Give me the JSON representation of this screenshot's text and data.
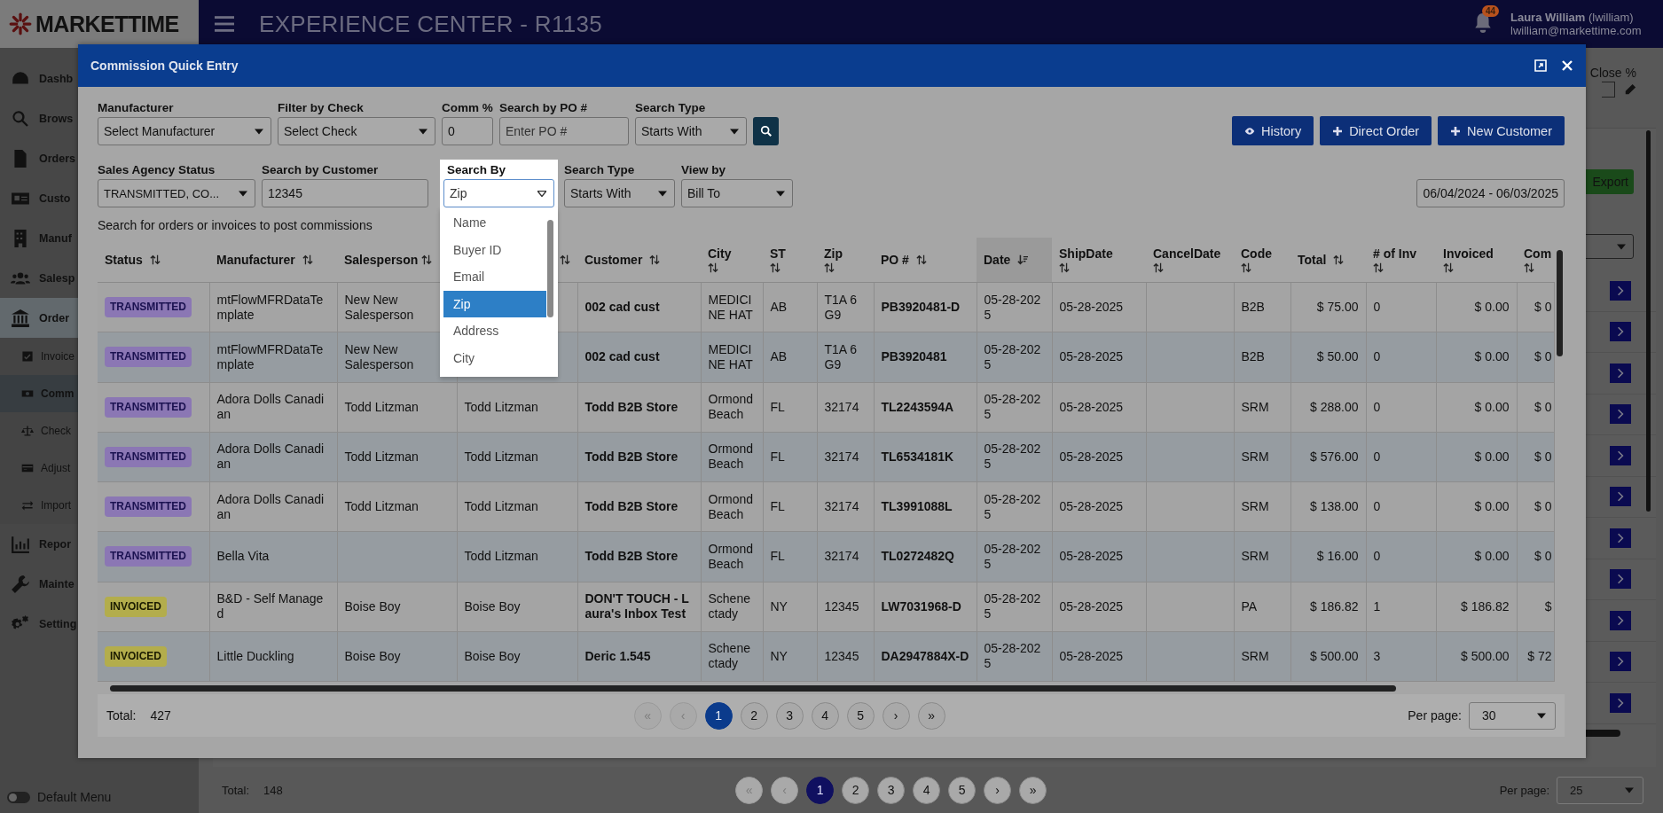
{
  "app": {
    "logo": "MARKETTIME",
    "title": "EXPERIENCE CENTER - R1135",
    "notifications": "44",
    "user_name": "**Laura William** (lwilliam)",
    "user_email": "lwilliam@markettime.com"
  },
  "sidebar": {
    "items": [
      {
        "label": "Dashb"
      },
      {
        "label": "Brows"
      },
      {
        "label": "Orders"
      },
      {
        "label": "Custo"
      },
      {
        "label": "Manuf"
      },
      {
        "label": "Salesp"
      },
      {
        "label": "Order",
        "expanded": true,
        "children": [
          {
            "label": "Invoice",
            "selected": false
          },
          {
            "label": "Comm",
            "selected": true
          },
          {
            "label": "Check",
            "selected": false
          },
          {
            "label": "Adjust",
            "selected": false
          },
          {
            "label": "Import",
            "selected": false
          }
        ]
      },
      {
        "label": "Repor"
      },
      {
        "label": "Mainte"
      },
      {
        "label": "Setting"
      }
    ],
    "toggle": {
      "label": "Default Menu",
      "on": false
    }
  },
  "background": {
    "close_label": "Close %",
    "export_button": "Export",
    "total_label": "Total:",
    "total": "148",
    "per_page_label": "Per page:",
    "per_page": "25",
    "pages": [
      {
        "label": "«",
        "selected": false,
        "disabled": true
      },
      {
        "label": "‹",
        "selected": false,
        "disabled": true
      },
      {
        "label": "1",
        "selected": true,
        "disabled": false
      },
      {
        "label": "2",
        "selected": false,
        "disabled": false
      },
      {
        "label": "3",
        "selected": false,
        "disabled": false
      },
      {
        "label": "4",
        "selected": false,
        "disabled": false
      },
      {
        "label": "5",
        "selected": false,
        "disabled": false
      },
      {
        "label": "›",
        "selected": false,
        "disabled": false
      },
      {
        "label": "»",
        "selected": false,
        "disabled": false
      }
    ]
  },
  "modal": {
    "title": "Commission Quick Entry",
    "filters_row1": [
      {
        "label": "Manufacturer",
        "kind": "select",
        "value": "Select Manufacturer"
      },
      {
        "label": "Filter by Check",
        "kind": "select",
        "value": "Select Check"
      },
      {
        "label": "Comm %",
        "kind": "input",
        "value": "0"
      },
      {
        "label": "Search by PO #",
        "kind": "input",
        "placeholder": "Enter PO #"
      },
      {
        "label": "Search Type",
        "kind": "select",
        "value": "Starts With"
      }
    ],
    "actions": [
      {
        "label": "History"
      },
      {
        "label": "Direct Order"
      },
      {
        "label": "New Customer"
      }
    ],
    "filters_row2": [
      {
        "label": "Sales Agency Status",
        "kind": "select",
        "value": "TRANSMITTED, CO..."
      },
      {
        "label": "Search by Customer",
        "kind": "input",
        "value": "12345"
      },
      {
        "label": "Search By",
        "kind": "dropdown",
        "value": "Zip",
        "options": [
          {
            "label": "Name",
            "selected": false
          },
          {
            "label": "Buyer ID",
            "selected": false
          },
          {
            "label": "Email",
            "selected": false
          },
          {
            "label": "Zip",
            "selected": true
          },
          {
            "label": "Address",
            "selected": false
          },
          {
            "label": "City",
            "selected": false
          }
        ]
      },
      {
        "label": "Search Type",
        "kind": "select",
        "value": "Starts With"
      },
      {
        "label": "View by",
        "kind": "select",
        "value": "Bill To"
      }
    ],
    "date_range": "06/04/2024 - 06/03/2025",
    "hint": "Search for orders or invoices to post commissions",
    "table": {
      "columns": [
        {
          "label": "Status",
          "selected": false
        },
        {
          "label": "Manufacturer",
          "selected": false
        },
        {
          "label": "Salesperson",
          "selected": false
        },
        {
          "selected": false
        },
        {
          "label": "Customer",
          "selected": false
        },
        {
          "label": "City",
          "selected": false
        },
        {
          "label": "ST",
          "selected": false
        },
        {
          "label": "Zip",
          "selected": false
        },
        {
          "label": "PO #",
          "selected": false
        },
        {
          "label": "Date",
          "selected": true
        },
        {
          "label": "ShipDate",
          "selected": false
        },
        {
          "label": "CancelDate",
          "selected": false
        },
        {
          "label": "Code",
          "selected": false
        },
        {
          "label": "Total",
          "selected": false
        },
        {
          "label": "# of Inv",
          "selected": false
        },
        {
          "label": "Invoiced",
          "selected": false
        },
        {
          "label": "Com",
          "selected": false
        }
      ],
      "rows": [
        {
          "kind": "transmitted",
          "cells": [
            "TRANSMITTED",
            "mtFlowMFRDataTemplate",
            "New New Salesperson",
            "",
            "002 cad cust",
            "MEDICINE HAT",
            "AB",
            "T1A 6G9",
            "PB3920481-D",
            "05-28-2025",
            "05-28-2025",
            "",
            "B2B",
            "$ 75.00",
            "0",
            "$ 0.00",
            "$ 0"
          ]
        },
        {
          "kind": "transmitted",
          "cells": [
            "TRANSMITTED",
            "mtFlowMFRDataTemplate",
            "New New Salesperson",
            "",
            "002 cad cust",
            "MEDICINE HAT",
            "AB",
            "T1A 6G9",
            "PB3920481",
            "05-28-2025",
            "05-28-2025",
            "",
            "B2B",
            "$ 50.00",
            "0",
            "$ 0.00",
            "$ 0"
          ]
        },
        {
          "kind": "transmitted",
          "cells": [
            "TRANSMITTED",
            "Adora Dolls Canadian",
            "Todd Litzman",
            "Todd Litzman",
            "Todd B2B Store",
            "Ormond Beach",
            "FL",
            "32174",
            "TL2243594A",
            "05-28-2025",
            "05-28-2025",
            "",
            "SRM",
            "$ 288.00",
            "0",
            "$ 0.00",
            "$ 0"
          ]
        },
        {
          "kind": "transmitted",
          "cells": [
            "TRANSMITTED",
            "Adora Dolls Canadian",
            "Todd Litzman",
            "Todd Litzman",
            "Todd B2B Store",
            "Ormond Beach",
            "FL",
            "32174",
            "TL6534181K",
            "05-28-2025",
            "05-28-2025",
            "",
            "SRM",
            "$ 576.00",
            "0",
            "$ 0.00",
            "$ 0"
          ]
        },
        {
          "kind": "transmitted",
          "cells": [
            "TRANSMITTED",
            "Adora Dolls Canadian",
            "Todd Litzman",
            "Todd Litzman",
            "Todd B2B Store",
            "Ormond Beach",
            "FL",
            "32174",
            "TL3991088L",
            "05-28-2025",
            "05-28-2025",
            "",
            "SRM",
            "$ 138.00",
            "0",
            "$ 0.00",
            "$ 0"
          ]
        },
        {
          "kind": "transmitted",
          "cells": [
            "TRANSMITTED",
            "Bella Vita",
            "",
            "Todd Litzman",
            "Todd B2B Store",
            "Ormond Beach",
            "FL",
            "32174",
            "TL0272482Q",
            "05-28-2025",
            "05-28-2025",
            "",
            "SRM",
            "$ 16.00",
            "0",
            "$ 0.00",
            "$ 0"
          ]
        },
        {
          "kind": "invoiced",
          "cells": [
            "INVOICED",
            "B&D - Self Managed",
            "Boise Boy",
            "Boise Boy",
            "DON'T TOUCH - Laura's Inbox Test",
            "Schenectady",
            "NY",
            "12345",
            "LW7031968-D",
            "05-28-2025",
            "05-28-2025",
            "",
            "PA",
            "$ 186.82",
            "1",
            "$ 186.82",
            "$"
          ]
        },
        {
          "kind": "invoiced",
          "cells": [
            "INVOICED",
            "Little Duckling",
            "Boise Boy",
            "Boise Boy",
            "Deric 1.545",
            "Schenectady",
            "NY",
            "12345",
            "DA2947884X-D",
            "05-28-2025",
            "05-28-2025",
            "",
            "SRM",
            "$ 500.00",
            "3",
            "$ 500.00",
            "$ 72"
          ]
        }
      ]
    },
    "footer": {
      "total_label": "Total:",
      "total": "427",
      "per_page_label": "Per page:",
      "per_page": "30",
      "pages": [
        {
          "label": "«",
          "selected": false,
          "disabled": true
        },
        {
          "label": "‹",
          "selected": false,
          "disabled": true
        },
        {
          "label": "1",
          "selected": true,
          "disabled": false
        },
        {
          "label": "2",
          "selected": false,
          "disabled": false
        },
        {
          "label": "3",
          "selected": false,
          "disabled": false
        },
        {
          "label": "4",
          "selected": false,
          "disabled": false
        },
        {
          "label": "5",
          "selected": false,
          "disabled": false
        },
        {
          "label": "›",
          "selected": false,
          "disabled": false
        },
        {
          "label": "»",
          "selected": false,
          "disabled": false
        }
      ]
    }
  }
}
